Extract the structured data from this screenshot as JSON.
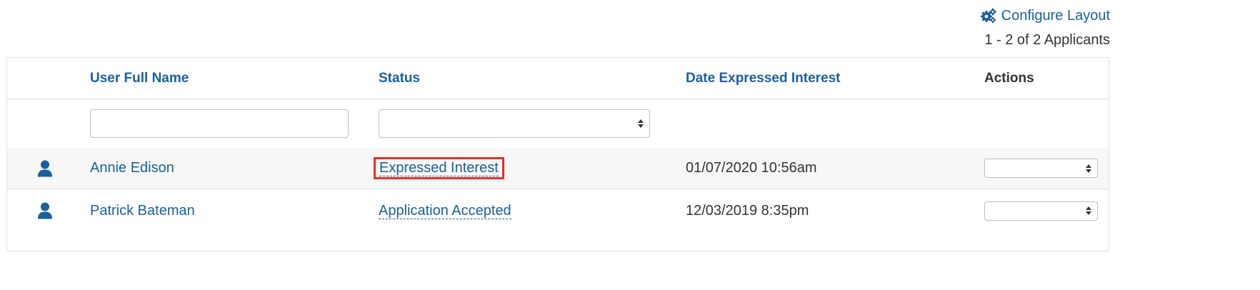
{
  "toolbar": {
    "configure_label": "Configure Layout",
    "count_label": "1 - 2 of 2 Applicants"
  },
  "table": {
    "headers": {
      "name": "User Full Name",
      "status": "Status",
      "date": "Date Expressed Interest",
      "actions": "Actions"
    },
    "filters": {
      "name_value": "",
      "status_value": ""
    },
    "rows": [
      {
        "name": "Annie Edison",
        "status": "Expressed Interest",
        "date": "01/07/2020 10:56am",
        "action_value": "",
        "highlighted": true
      },
      {
        "name": "Patrick Bateman",
        "status": "Application Accepted",
        "date": "12/03/2019 8:35pm",
        "action_value": "",
        "highlighted": false
      }
    ]
  },
  "colors": {
    "link": "#1a5f9e",
    "highlight": "#e53224",
    "row_alt": "#f7f7f7"
  },
  "icons": {
    "configure": "gears-icon",
    "user": "user-icon"
  }
}
